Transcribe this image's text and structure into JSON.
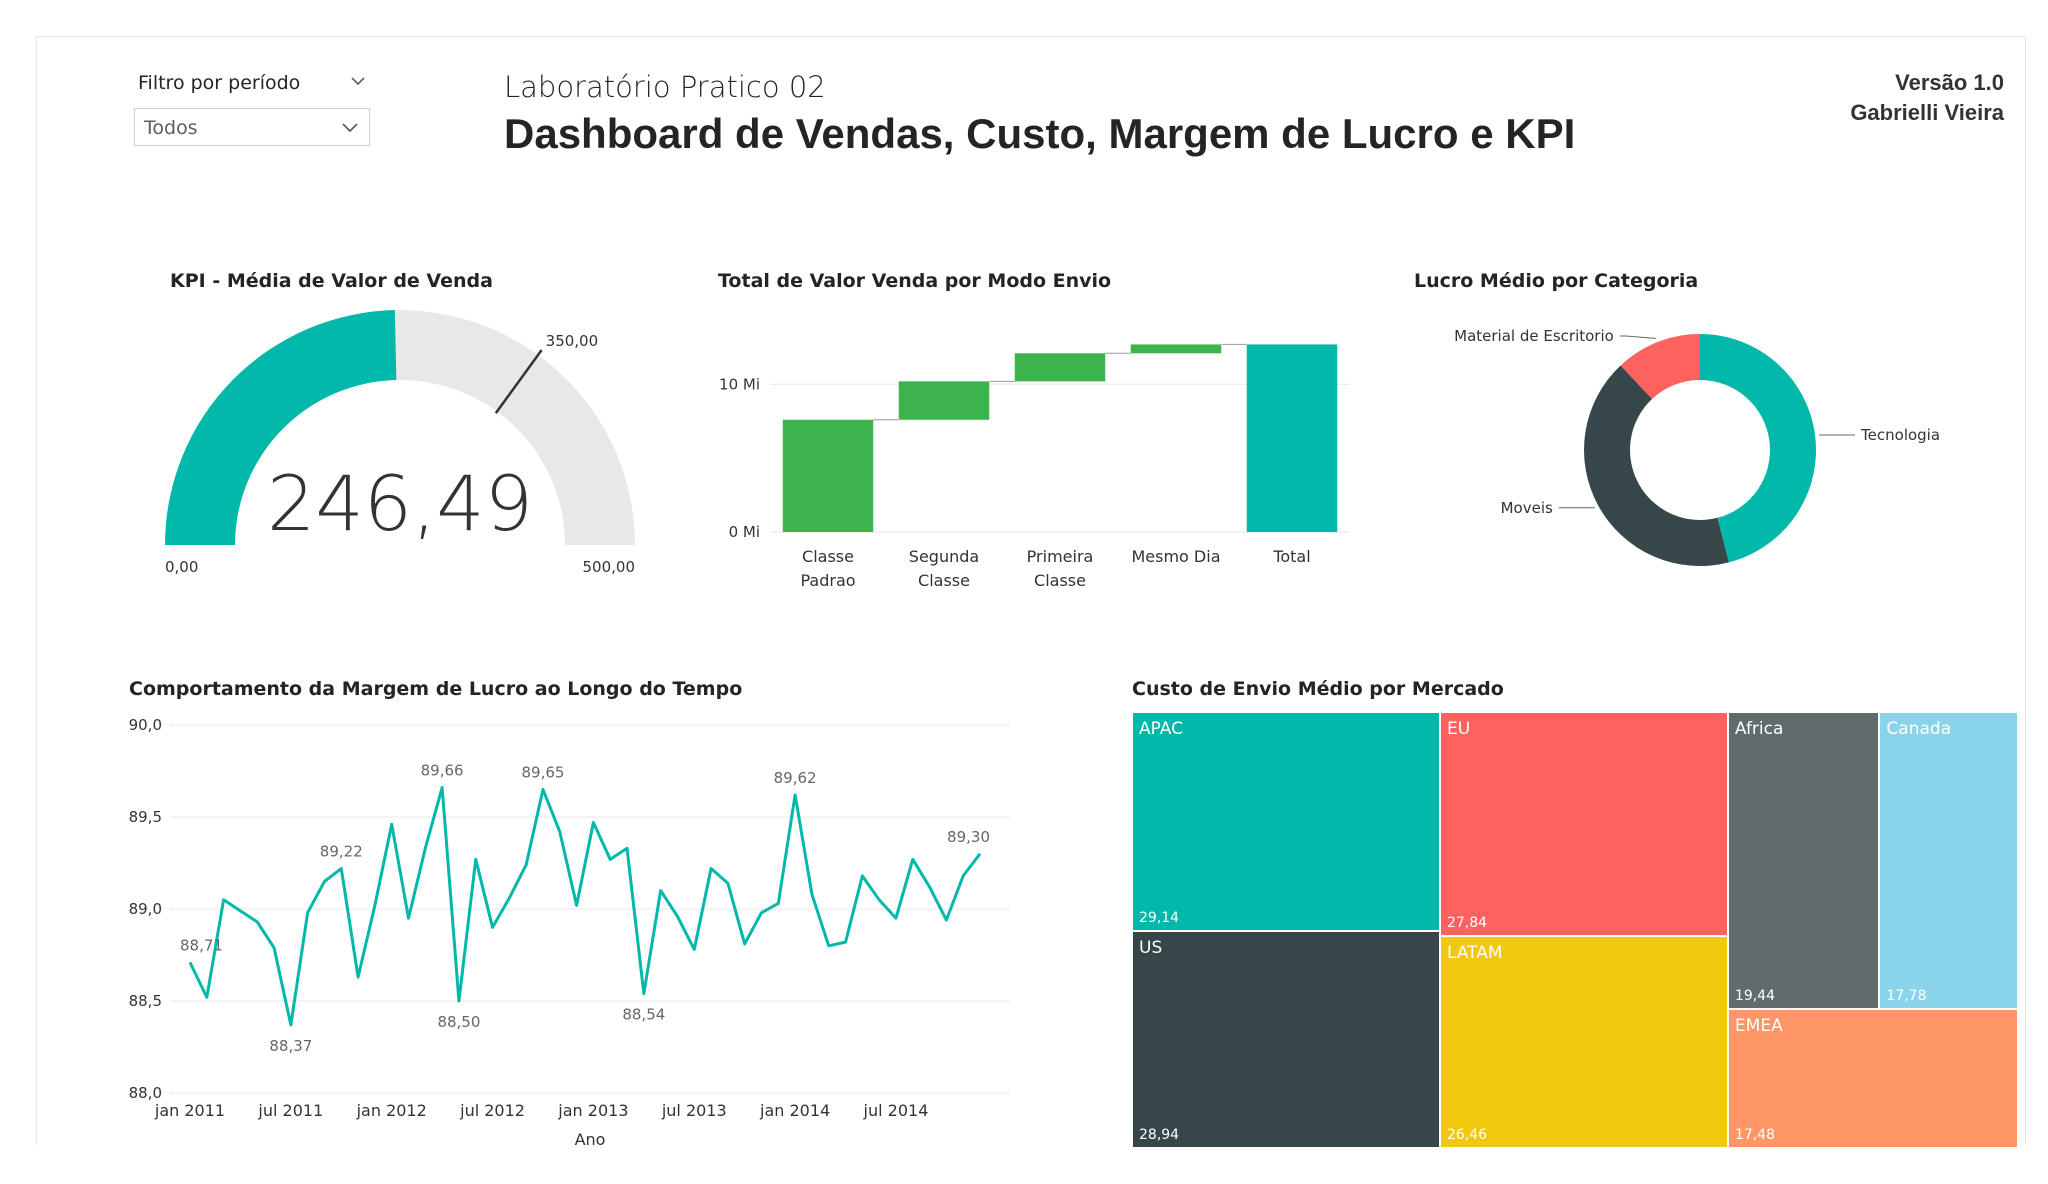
{
  "filter": {
    "label": "Filtro por período",
    "value": "Todos"
  },
  "header": {
    "subtitle": "Laboratório Pratico 02",
    "title": "Dashboard de Vendas, Custo, Margem de Lucro e KPI",
    "version": "Versão 1.0",
    "author": "Gabrielli Vieira"
  },
  "gauge": {
    "title": "KPI - Média de Valor de Venda",
    "value": 246.49,
    "value_label": "246,49",
    "min": 0,
    "max": 500,
    "target": 350,
    "min_label": "0,00",
    "max_label": "500,00",
    "target_label": "350,00",
    "fill_color": "#01B8AA",
    "track_color": "#E8E8E8"
  },
  "chart_data": [
    {
      "type": "bar",
      "subtype": "waterfall",
      "title": "Total de Valor Venda por Modo Envio",
      "categories": [
        "Classe Padrao",
        "Segunda Classe",
        "Primeira Classe",
        "Mesmo Dia",
        "Total"
      ],
      "category_lines": [
        [
          "Classe",
          "Padrao"
        ],
        [
          "Segunda",
          "Classe"
        ],
        [
          "Primeira",
          "Classe"
        ],
        [
          "Mesmo Dia"
        ],
        [
          "Total"
        ]
      ],
      "values": [
        7.6,
        2.6,
        1.9,
        0.6,
        12.7
      ],
      "y_ticks": [
        "0 Mi",
        "10 Mi"
      ],
      "ylim": [
        0,
        13
      ],
      "colors": {
        "increase": "#3CB44B",
        "total": "#01B8AA"
      }
    },
    {
      "type": "pie",
      "subtype": "donut",
      "title": "Lucro Médio por Categoria",
      "labels": [
        "Tecnologia",
        "Moveis",
        "Material de Escritorio"
      ],
      "values": [
        46,
        42,
        12
      ],
      "colors": [
        "#01B8AA",
        "#374649",
        "#FD625E"
      ]
    },
    {
      "type": "line",
      "title": "Comportamento da Margem de Lucro ao Longo do Tempo",
      "xlabel": "Ano",
      "ylabel": "",
      "x_ticks": [
        "jan 2011",
        "jul 2011",
        "jan 2012",
        "jul 2012",
        "jan 2013",
        "jul 2013",
        "jan 2014",
        "jul 2014"
      ],
      "y_ticks": [
        "88,0",
        "88,5",
        "89,0",
        "89,5",
        "90,0"
      ],
      "ylim": [
        88.0,
        90.0
      ],
      "values": [
        88.71,
        88.52,
        89.05,
        88.99,
        88.93,
        88.79,
        88.37,
        88.98,
        89.15,
        89.22,
        88.63,
        89.02,
        89.46,
        88.95,
        89.33,
        89.66,
        88.5,
        89.27,
        88.9,
        89.06,
        89.24,
        89.65,
        89.42,
        89.02,
        89.47,
        89.27,
        89.33,
        88.54,
        89.1,
        88.96,
        88.78,
        89.22,
        89.14,
        88.81,
        88.98,
        89.03,
        89.62,
        89.08,
        88.8,
        88.82,
        89.18,
        89.05,
        88.95,
        89.27,
        89.12,
        88.94,
        89.18,
        89.3
      ],
      "data_labels": [
        {
          "index": 0,
          "text": "88,71"
        },
        {
          "index": 6,
          "text": "88,37"
        },
        {
          "index": 9,
          "text": "89,22"
        },
        {
          "index": 15,
          "text": "89,66"
        },
        {
          "index": 16,
          "text": "88,50"
        },
        {
          "index": 21,
          "text": "89,65"
        },
        {
          "index": 27,
          "text": "88,54"
        },
        {
          "index": 36,
          "text": "89,62"
        },
        {
          "index": 47,
          "text": "89,30"
        }
      ],
      "color": "#01B8AA"
    },
    {
      "type": "treemap",
      "title": "Custo de Envio Médio por Mercado",
      "items": [
        {
          "name": "APAC",
          "value": 29.14,
          "label": "29,14",
          "color": "#01B8AA"
        },
        {
          "name": "US",
          "value": 28.94,
          "label": "28,94",
          "color": "#374649"
        },
        {
          "name": "EU",
          "value": 27.84,
          "label": "27,84",
          "color": "#FD625E"
        },
        {
          "name": "LATAM",
          "value": 26.46,
          "label": "26,46",
          "color": "#F2C80F"
        },
        {
          "name": "Africa",
          "value": 19.44,
          "label": "19,44",
          "color": "#5F6B6D"
        },
        {
          "name": "Canada",
          "value": 17.78,
          "label": "17,78",
          "color": "#8AD4EB"
        },
        {
          "name": "EMEA",
          "value": 17.48,
          "label": "17,48",
          "color": "#FE9666"
        }
      ]
    }
  ]
}
